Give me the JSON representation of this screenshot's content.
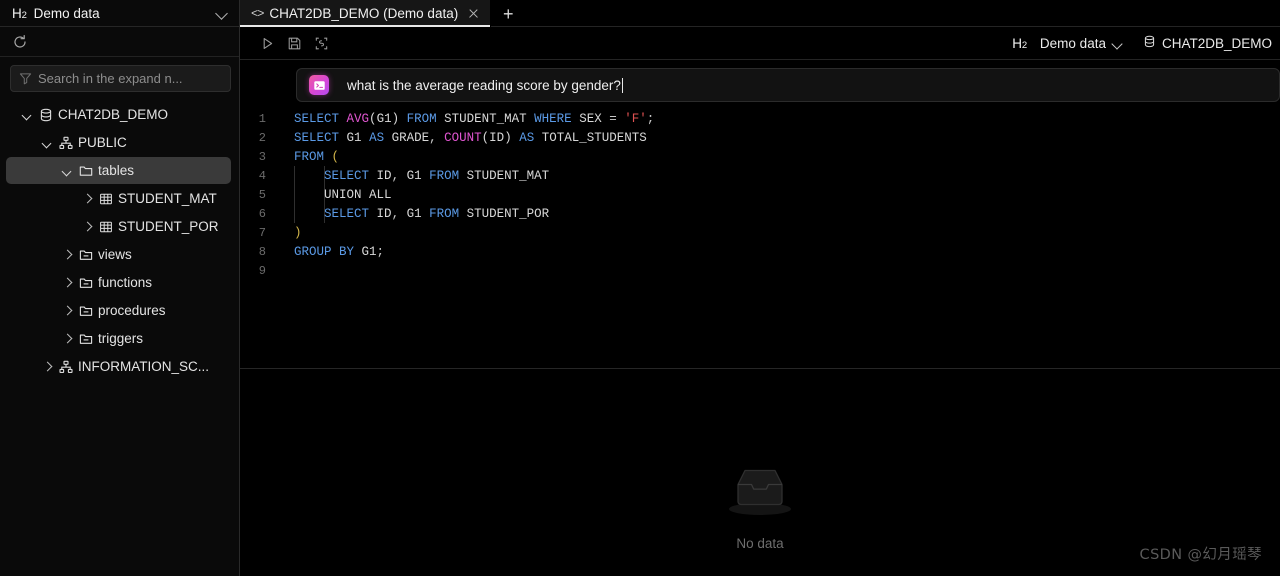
{
  "sidebar": {
    "connection": {
      "logo": "H",
      "logo_sub": "2",
      "name": "Demo data",
      "chevron_icon": "chevron-down-icon"
    },
    "refresh_icon": "refresh-icon",
    "search": {
      "placeholder": "Search in the expand n...",
      "icon": "filter-icon"
    },
    "tree": [
      {
        "label": "CHAT2DB_DEMO",
        "icon": "database-icon",
        "depth": 0,
        "state": "expanded",
        "selected": false
      },
      {
        "label": "PUBLIC",
        "icon": "schema-icon",
        "depth": 1,
        "state": "expanded",
        "selected": false
      },
      {
        "label": "tables",
        "icon": "folder-open-icon",
        "depth": 2,
        "state": "expanded",
        "selected": true
      },
      {
        "label": "STUDENT_MAT",
        "icon": "table-icon",
        "depth": 3,
        "state": "collapsed",
        "selected": false
      },
      {
        "label": "STUDENT_POR",
        "icon": "table-icon",
        "depth": 3,
        "state": "collapsed",
        "selected": false
      },
      {
        "label": "views",
        "icon": "folder-icon",
        "depth": 2,
        "state": "collapsed",
        "selected": false
      },
      {
        "label": "functions",
        "icon": "folder-icon",
        "depth": 2,
        "state": "collapsed",
        "selected": false
      },
      {
        "label": "procedures",
        "icon": "folder-icon",
        "depth": 2,
        "state": "collapsed",
        "selected": false
      },
      {
        "label": "triggers",
        "icon": "folder-icon",
        "depth": 2,
        "state": "collapsed",
        "selected": false
      },
      {
        "label": "INFORMATION_SC...",
        "icon": "schema-icon",
        "depth": 1,
        "state": "collapsed",
        "selected": false
      }
    ]
  },
  "tabs": {
    "items": [
      {
        "title": "CHAT2DB_DEMO (Demo data)",
        "icon": "code-tag-icon",
        "active": true,
        "close_icon": "close-icon"
      }
    ],
    "new_tab_label": "+"
  },
  "toolbar": {
    "run_icon": "play-icon",
    "save_icon": "save-icon",
    "format_icon": "format-sql-icon",
    "connection_logo": "H",
    "connection_logo_sub": "2",
    "connection_label": "Demo data",
    "database_icon": "database-icon",
    "database_label": "CHAT2DB_DEMO"
  },
  "prompt": {
    "icon": "ai-assistant-icon",
    "value": "what is the average reading score by gender?",
    "cursor": true
  },
  "editor": {
    "lines": [
      "1",
      "2",
      "3",
      "4",
      "5",
      "6",
      "7",
      "8",
      "9"
    ],
    "code": [
      "SELECT AVG(G1) FROM STUDENT_MAT WHERE SEX = 'F';",
      "SELECT G1 AS GRADE, COUNT(ID) AS TOTAL_STUDENTS",
      "FROM (",
      "    SELECT ID, G1 FROM STUDENT_MAT",
      "    UNION ALL",
      "    SELECT ID, G1 FROM STUDENT_POR",
      ")",
      "GROUP BY G1;",
      ""
    ]
  },
  "results": {
    "empty_icon": "empty-box-icon",
    "empty_label": "No data"
  },
  "watermark": "CSDN @幻月瑶琴",
  "colors": {
    "background": "#000000",
    "sidebar_bg": "#0a0a0a",
    "selection": "#3a3a3a",
    "keyword": "#5b9ae6",
    "function": "#e055d0",
    "string": "#e05252",
    "identifier": "#d8d8d8",
    "accent_tab_underline": "#e9e9e9"
  }
}
